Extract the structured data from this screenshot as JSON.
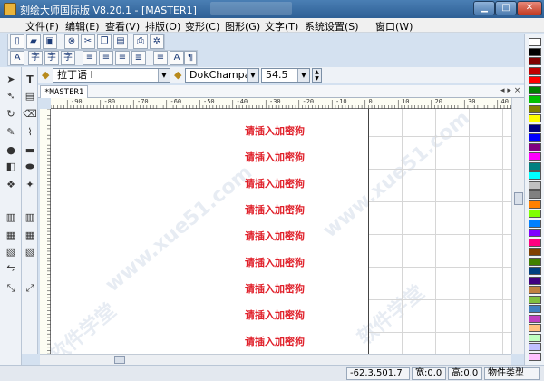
{
  "window": {
    "title": "刻绘大师国际版 V8.20.1 - [MASTER1]"
  },
  "menu": {
    "items": [
      "文件(F)",
      "编辑(E)",
      "查看(V)",
      "排版(O)",
      "变形(C)",
      "图形(G)",
      "文字(T)",
      "系统设置(S)",
      "窗口(W)"
    ]
  },
  "font_toolbar": {
    "script_value": "拉丁语 I",
    "font_value": "DokChampa",
    "size_value": "54.5"
  },
  "tab": {
    "label": "*MASTER1",
    "nav_arrows": "◂ ▸ ×"
  },
  "ruler": {
    "labels": [
      "-90",
      "-80",
      "-70",
      "-60",
      "-50",
      "-40",
      "-30",
      "-20",
      "-10",
      "0",
      "10",
      "20",
      "30",
      "40"
    ]
  },
  "canvas": {
    "placeholder_text": "请插入加密狗",
    "placeholder_count": 9,
    "watermark": "www.xue51.com",
    "watermark2": "软件学堂"
  },
  "status": {
    "coords": "-62.3,501.7",
    "width": "宽:0.0",
    "height": "高:0.0",
    "type": "物件类型"
  },
  "colors": [
    "#ffffff",
    "#000000",
    "#800000",
    "#c00000",
    "#ff0000",
    "#008000",
    "#00c000",
    "#808000",
    "#ffff00",
    "#000080",
    "#0000ff",
    "#800080",
    "#ff00ff",
    "#008080",
    "#00ffff",
    "#c0c0c0",
    "#808080",
    "#ff8000",
    "#80ff00",
    "#0080ff",
    "#8000ff",
    "#ff0080",
    "#804000",
    "#408000",
    "#004080",
    "#400080",
    "#c08040",
    "#80c040",
    "#4080c0",
    "#c040c0",
    "#ffc080",
    "#c0ffc0",
    "#c0c0ff",
    "#ffc0ff"
  ]
}
